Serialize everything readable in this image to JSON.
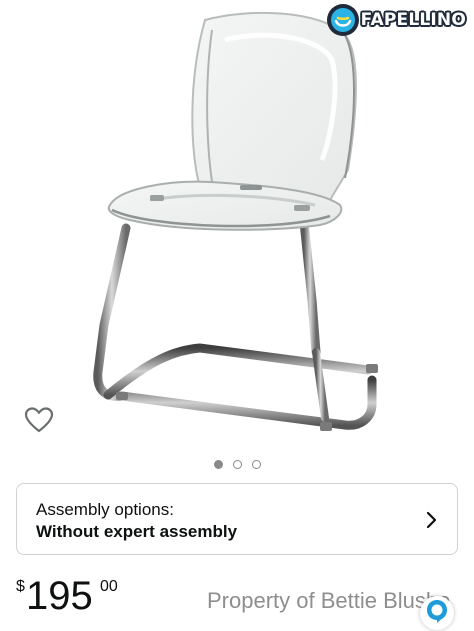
{
  "product": {
    "image_alt": "Clear acrylic chair with chrome cantilever base",
    "carousel": {
      "total": 3,
      "active": 0
    }
  },
  "watermark": {
    "logo_text": "FAPELLINO",
    "property_text": "Property of Bettie Blushe"
  },
  "assembly": {
    "title": "Assembly options:",
    "value": "Without expert assembly"
  },
  "price": {
    "currency": "$",
    "whole": "195",
    "fraction": "00"
  },
  "icons": {
    "wishlist": "heart-outline-icon",
    "chevron": "chevron-right-icon",
    "assistant": "assistant-icon"
  },
  "colors": {
    "text": "#0f1111",
    "muted": "#8e8e8e",
    "border": "#cfd3d4",
    "accent": "#1f9bd7"
  }
}
